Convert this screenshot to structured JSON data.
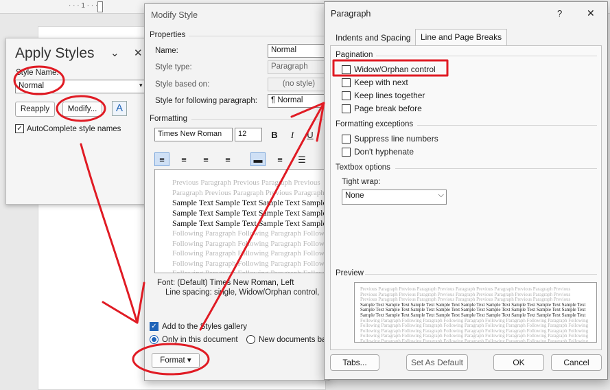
{
  "ruler": {
    "marks": "· · · 1 · · · 1"
  },
  "apply_styles": {
    "title": "Apply Styles",
    "style_name_label": "Style Name:",
    "style_name_value": "Normal",
    "reapply": "Reapply",
    "modify": "Modify...",
    "autocomplete_label": "AutoComplete style names"
  },
  "modify_style": {
    "title": "Modify Style",
    "properties_header": "Properties",
    "name_label": "Name:",
    "name_value": "Normal",
    "style_type_label": "Style type:",
    "style_type_value": "Paragraph",
    "based_on_label": "Style based on:",
    "based_on_value": "(no style)",
    "following_label": "Style for following paragraph:",
    "following_value": "¶  Normal",
    "formatting_header": "Formatting",
    "font_value": "Times New Roman",
    "size_value": "12",
    "bold": "B",
    "italic": "I",
    "underline": "U",
    "preview_prev1": "Previous Paragraph Previous Paragraph Previous",
    "preview_prev2": "Paragraph Previous Paragraph Previous Paragraph",
    "preview_sample": "Sample Text Sample Text Sample Text Sample Text",
    "preview_follow": "Following Paragraph Following Paragraph Following",
    "desc_line1": "Font: (Default) Times New Roman, Left",
    "desc_line2": "Line spacing:  single, Widow/Orphan control,",
    "add_gallery": "Add to the Styles gallery",
    "only_doc": "Only in this document",
    "new_docs": "New documents ba",
    "format_btn": "Format ▾"
  },
  "paragraph": {
    "title": "Paragraph",
    "help": "?",
    "close": "✕",
    "tab_indents": "Indents and Spacing",
    "tab_breaks": "Line and Page Breaks",
    "pagination_header": "Pagination",
    "widow_orphan": "Widow/Orphan control",
    "keep_next": "Keep with next",
    "keep_lines": "Keep lines together",
    "page_break": "Page break before",
    "exceptions_header": "Formatting exceptions",
    "suppress_lines": "Suppress line numbers",
    "dont_hyphenate": "Don't hyphenate",
    "textbox_header": "Textbox options",
    "tight_wrap_label": "Tight wrap:",
    "tight_wrap_value": "None",
    "preview_header": "Preview",
    "prev_prev": "Previous Paragraph Previous Paragraph Previous Paragraph Previous Paragraph Previous Paragraph Previous",
    "prev_sample": "Sample Text Sample Text Sample Text Sample Text Sample Text Sample Text Sample Text Sample Text Sample Text",
    "prev_follow": "Following Paragraph Following Paragraph Following Paragraph Following Paragraph Following Paragraph Following",
    "tabs_btn": "Tabs...",
    "default_btn": "Set As Default",
    "ok_btn": "OK",
    "cancel_btn": "Cancel"
  },
  "colors": {
    "annotation": "#e01b24",
    "accent": "#1e63b8"
  }
}
